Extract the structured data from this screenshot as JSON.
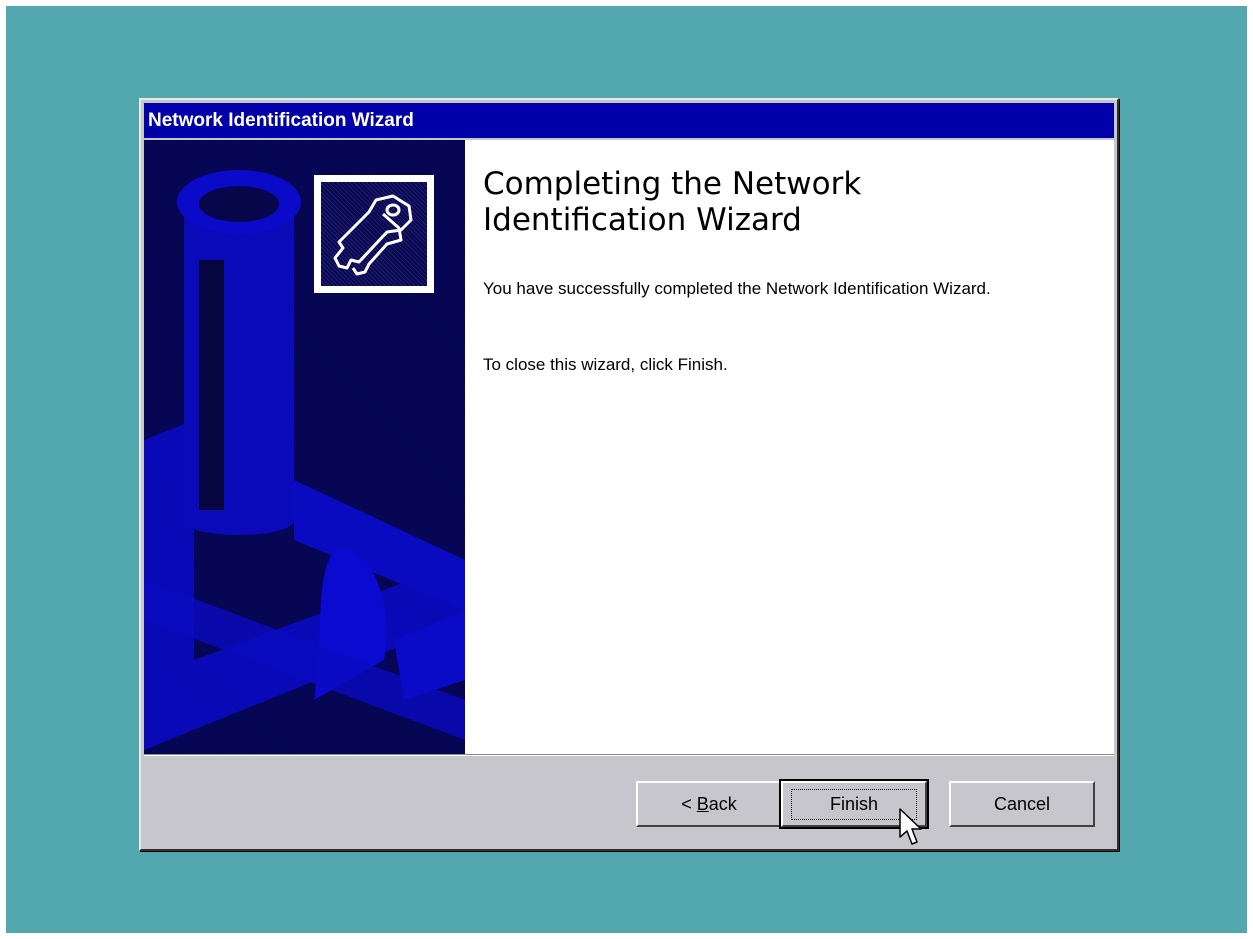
{
  "window": {
    "title": "Network Identification Wizard"
  },
  "content": {
    "heading": "Completing the Network Identification Wizard",
    "paragraph_1": "You have successfully completed the Network Identification Wizard.",
    "paragraph_2": "To close this wizard, click Finish."
  },
  "buttons": {
    "back_prefix": "< ",
    "back_mnemonic": "B",
    "back_suffix": "ack",
    "finish": "Finish",
    "cancel": "Cancel"
  },
  "icons": {
    "wizard_icon": "keys-icon",
    "cursor": "mouse-pointer-icon"
  },
  "colors": {
    "desktop": "#52a8ae",
    "titlebar": "#0000a8",
    "dialog_face": "#c7c6cc"
  }
}
